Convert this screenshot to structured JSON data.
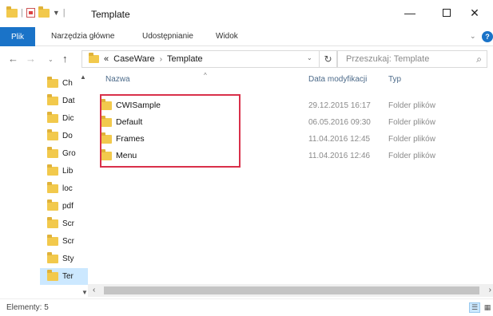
{
  "window": {
    "title": "Template",
    "controls": {
      "minimize": "—",
      "maximize": "",
      "close": "✕"
    }
  },
  "ribbon": {
    "file_tab": "Plik",
    "tabs": [
      "Narzędzia główne",
      "Udostępnianie",
      "Widok"
    ],
    "help": "?"
  },
  "address": {
    "prefix": "«",
    "crumbs": [
      "CaseWare",
      "Template"
    ],
    "separator": "›"
  },
  "search": {
    "placeholder": "Przeszukaj: Template"
  },
  "nav_pane": {
    "items": [
      {
        "label": "Ch"
      },
      {
        "label": "Dat"
      },
      {
        "label": "Dic"
      },
      {
        "label": "Do"
      },
      {
        "label": "Gro"
      },
      {
        "label": "Lib"
      },
      {
        "label": "loc"
      },
      {
        "label": "pdf"
      },
      {
        "label": "Scr"
      },
      {
        "label": "Scr"
      },
      {
        "label": "Sty"
      },
      {
        "label": "Ter",
        "selected": true
      }
    ]
  },
  "columns": {
    "name": "Nazwa",
    "date": "Data modyfikacji",
    "type": "Typ"
  },
  "files": [
    {
      "name": "CWISample",
      "date": "29.12.2015 16:17",
      "type": "Folder plików"
    },
    {
      "name": "Default",
      "date": "06.05.2016 09:30",
      "type": "Folder plików"
    },
    {
      "name": "Frames",
      "date": "11.04.2016 12:45",
      "type": "Folder plików"
    },
    {
      "name": "Menu",
      "date": "11.04.2016 12:46",
      "type": "Folder plików"
    }
  ],
  "status": {
    "text": "Elementy: 5"
  },
  "colors": {
    "accent": "#1a73c8",
    "highlight_box": "#d9304a",
    "selection": "#cce8ff",
    "folder": "#f2c94c"
  }
}
